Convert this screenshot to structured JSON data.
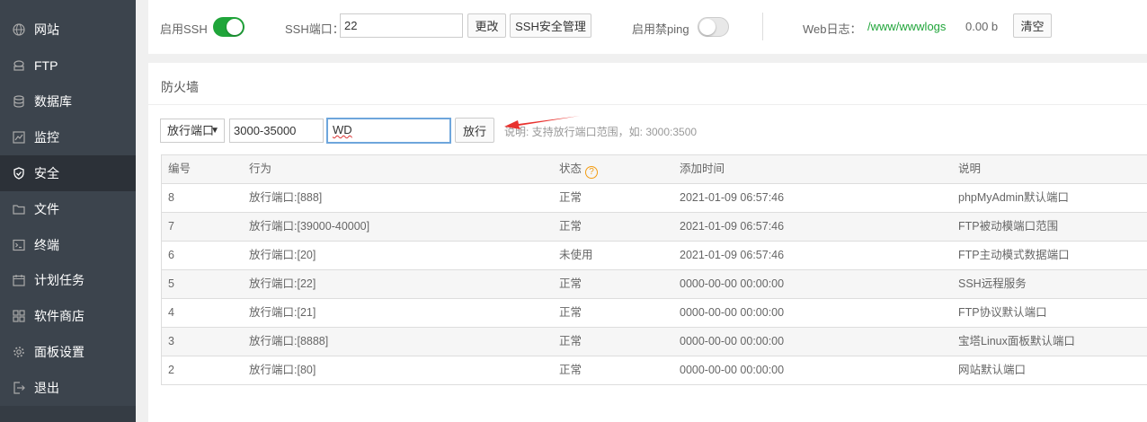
{
  "sidebar": {
    "items": [
      {
        "label": "网站",
        "icon": "globe-icon"
      },
      {
        "label": "FTP",
        "icon": "ftp-icon"
      },
      {
        "label": "数据库",
        "icon": "database-icon"
      },
      {
        "label": "监控",
        "icon": "monitor-icon"
      },
      {
        "label": "安全",
        "icon": "shield-icon",
        "active": true
      },
      {
        "label": "文件",
        "icon": "folder-icon"
      },
      {
        "label": "终端",
        "icon": "terminal-icon"
      },
      {
        "label": "计划任务",
        "icon": "calendar-icon"
      },
      {
        "label": "软件商店",
        "icon": "apps-icon"
      },
      {
        "label": "面板设置",
        "icon": "gear-icon"
      },
      {
        "label": "退出",
        "icon": "logout-icon"
      }
    ]
  },
  "top": {
    "ssh_label": "启用SSH",
    "ssh_enabled": true,
    "ssh_port_label": "SSH端口：",
    "ssh_port_value": "22",
    "change_btn": "更改",
    "ssh_security_btn": "SSH安全管理",
    "ping_label": "启用禁ping",
    "ping_enabled": false,
    "weblog_label": "Web日志：",
    "weblog_path": "/www/wwwlogs",
    "weblog_size": "0.00 b",
    "clear_btn": "清空"
  },
  "firewall": {
    "title": "防火墙",
    "rule_type": "放行端口",
    "port_value": "3000-35000",
    "remark_value": "WD",
    "allow_btn": "放行",
    "hint": "说明: 支持放行端口范围，如: 3000:3500",
    "columns": [
      "编号",
      "行为",
      "状态",
      "添加时间",
      "说明"
    ],
    "rows": [
      {
        "id": "8",
        "action": "放行端口:[888]",
        "status": "正常",
        "time": "2021-01-09 06:57:46",
        "note": "phpMyAdmin默认端口"
      },
      {
        "id": "7",
        "action": "放行端口:[39000-40000]",
        "status": "正常",
        "time": "2021-01-09 06:57:46",
        "note": "FTP被动模端口范围"
      },
      {
        "id": "6",
        "action": "放行端口:[20]",
        "status": "未使用",
        "time": "2021-01-09 06:57:46",
        "note": "FTP主动模式数据端口"
      },
      {
        "id": "5",
        "action": "放行端口:[22]",
        "status": "正常",
        "time": "0000-00-00 00:00:00",
        "note": "SSH远程服务"
      },
      {
        "id": "4",
        "action": "放行端口:[21]",
        "status": "正常",
        "time": "0000-00-00 00:00:00",
        "note": "FTP协议默认端口"
      },
      {
        "id": "3",
        "action": "放行端口:[8888]",
        "status": "正常",
        "time": "0000-00-00 00:00:00",
        "note": "宝塔Linux面板默认端口"
      },
      {
        "id": "2",
        "action": "放行端口:[80]",
        "status": "正常",
        "time": "0000-00-00 00:00:00",
        "note": "网站默认端口"
      }
    ]
  },
  "colors": {
    "sidebar_bg": "#3c444d",
    "sidebar_active": "#2c3138",
    "toggle_on": "#20a53a",
    "path_green": "#20a53a",
    "arrow_red": "#e8322e",
    "help_orange": "#f39c12"
  }
}
